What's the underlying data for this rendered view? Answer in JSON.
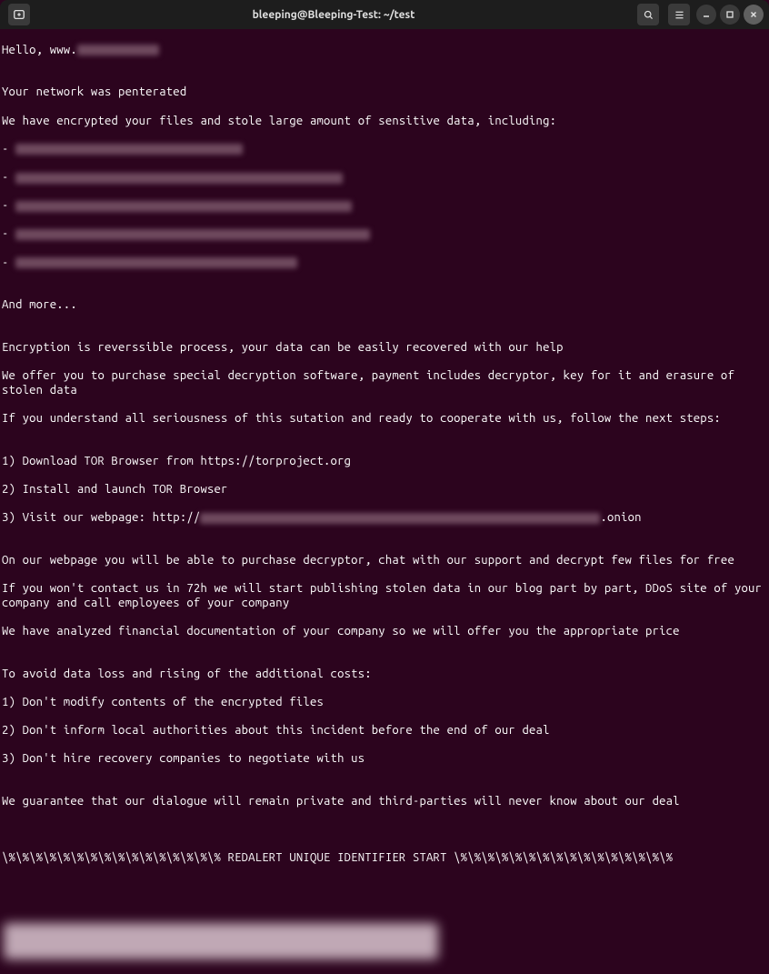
{
  "titlebar": {
    "title": "bleeping@Bleeping-Test: ~/test"
  },
  "content": {
    "l1a": "Hello, www.",
    "l2": "",
    "l3": "Your network was penterated",
    "l4": "We have encrypted your files and stole large amount of sensitive data, including:",
    "dash": "- ",
    "l10": "",
    "l11": "And more...",
    "l12": "",
    "l13": "Encryption is reverssible process, your data can be easily recovered with our help",
    "l14": "We offer you to purchase special decryption software, payment includes decryptor, key for it and erasure of stolen data",
    "l15": "If you understand all seriousness of this sutation and ready to cooperate with us, follow the next steps:",
    "l16": "",
    "l17": "1) Download TOR Browser from https://torproject.org",
    "l18": "2) Install and launch TOR Browser",
    "l19a": "3) Visit our webpage: http://",
    "l19b": ".onion",
    "l20": "",
    "l21": "On our webpage you will be able to purchase decryptor, chat with our support and decrypt few files for free",
    "l22": "If you won't contact us in 72h we will start publishing stolen data in our blog part by part, DDoS site of your company and call employees of your company",
    "l23": "We have analyzed financial documentation of your company so we will offer you the appropriate price",
    "l24": "",
    "l25": "To avoid data loss and rising of the additional costs:",
    "l26": "1) Don't modify contents of the encrypted files",
    "l27": "2) Don't inform local authorities about this incident before the end of our deal",
    "l28": "3) Don't hire recovery companies to negotiate with us",
    "l29": "",
    "l30": "We guarantee that our dialogue will remain private and third-parties will never know about our deal",
    "l31": "",
    "l32": "",
    "l33": "\\%\\%\\%\\%\\%\\%\\%\\%\\%\\%\\%\\%\\%\\%\\%\\% REDALERT UNIQUE IDENTIFIER START \\%\\%\\%\\%\\%\\%\\%\\%\\%\\%\\%\\%\\%\\%\\%\\%"
  }
}
